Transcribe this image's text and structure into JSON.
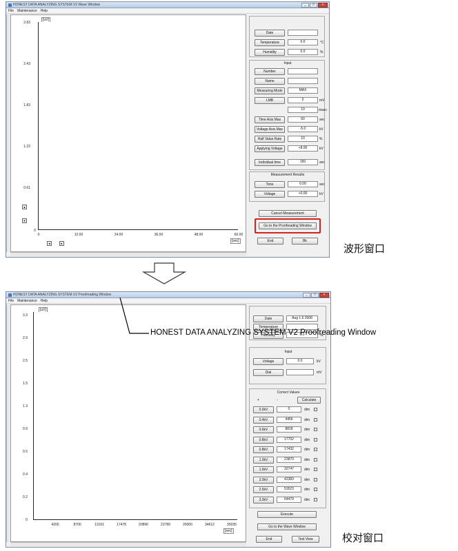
{
  "window1": {
    "title": "HONEST DATA ANALYZING SYSTEM V2 Wave Window",
    "menu": [
      "File",
      "Maintenance",
      "Help"
    ],
    "y_unit": "[uV]",
    "x_unit": "[sec]",
    "y_ticks": [
      "2.83",
      "2.43",
      "1.83",
      "1.22",
      "0.61",
      "0"
    ],
    "x_ticks": [
      "0",
      "12.00",
      "24.00",
      "36.00",
      "48.00",
      "60.00"
    ],
    "side": {
      "date_label": "Date",
      "temperature_label": "Temperature",
      "temperature_value": "0.0",
      "temperature_unit": "°C",
      "humidity_label": "Humidity",
      "humidity_value": "0.0",
      "humidity_unit": "%",
      "input_title": "Input",
      "number_label": "Number",
      "name_label": "Name",
      "method_label": "Measuring Mode",
      "method_value": "MAX",
      "lmb_label": "LMB",
      "lmb_value": "0",
      "lmb_unit": "mV",
      "second_value": "10",
      "second_unit": "msec",
      "time_axis_label": "Time Axis Max",
      "time_axis_value": "60",
      "time_axis_unit": "sec",
      "voltage_axis_label": "Voltage Axis Max",
      "voltage_axis_value": "-5.0",
      "voltage_axis_unit": "kV",
      "half_value_label": "Half Value Rate",
      "half_value_value": "10",
      "half_value_unit": "%",
      "applying_voltage_label": "Applying Voltage",
      "applying_voltage_value": "+8.00",
      "applying_voltage_unit": "kV",
      "individual_label": "Individual time",
      "individual_value": "150",
      "individual_unit": "sec",
      "result_title": "Measurement Results",
      "time_label": "Time",
      "time_value": "0.00",
      "time_unit": "sec",
      "voltage_label": "Voltage",
      "voltage_value": "+0.00",
      "voltage_unit": "kV",
      "cancel_label": "Cancel Measurement",
      "goto_label": "Go to the Proofreading Window",
      "end_label": "End",
      "exit_label": "Bk"
    },
    "caption": "波形窗口"
  },
  "window2": {
    "title": "HONEST DATA ANALYZING SYSTEM V2 Proofreading Window",
    "menu": [
      "File",
      "Maintenance",
      "Help"
    ],
    "y_unit": "[uV]",
    "x_unit": "[sec]",
    "y_ticks": [
      "3.3",
      "2.9",
      "2.5",
      "1.5",
      "1.3",
      "0.9",
      "0.5",
      "0.4",
      "0.2",
      "0"
    ],
    "x_ticks": [
      "4200",
      "8700",
      "13161",
      "17478",
      "20890",
      "22789",
      "26000",
      "34612",
      "35035"
    ],
    "side": {
      "date_label": "Date",
      "date_value": "Aug 1.6 2008",
      "temperature_label": "Temperature",
      "humidity_label": "Humidity",
      "humidity_value": "0.0",
      "humidity_unit": "%",
      "input_title": "Input",
      "voltage_label": "Voltage",
      "voltage_value": "0.0",
      "voltage_unit": "kV",
      "dial_label": "Dial",
      "dial_unit": "mV",
      "correction_title": "Correct Values",
      "radio_a": "+",
      "radio_b": "-",
      "calc_label": "Calculate",
      "rows": [
        {
          "label": "0.0kV",
          "value": "0",
          "unit": "dim"
        },
        {
          "label": "0.4kV",
          "value": "4456",
          "unit": "dim"
        },
        {
          "label": "0.6kV",
          "value": "8818",
          "unit": "dim"
        },
        {
          "label": "0.8kV",
          "value": "17702",
          "unit": "dim"
        },
        {
          "label": "0.8kV",
          "value": "17432",
          "unit": "dim"
        },
        {
          "label": "1.0kV",
          "value": "23870",
          "unit": "dim"
        },
        {
          "label": "1.5kV",
          "value": "32747",
          "unit": "dim"
        },
        {
          "label": "2.0kV",
          "value": "42383",
          "unit": "dim"
        },
        {
          "label": "2.5kV",
          "value": "53523",
          "unit": "dim"
        },
        {
          "label": "3.0kV",
          "value": "64479",
          "unit": "dim"
        }
      ],
      "execute_label": "Execute",
      "goto_label": "Go to the Wave Window",
      "end_label": "End",
      "test_label": "Test View"
    },
    "caption": "校对窗口"
  },
  "callout_text": "HONEST DATA ANALYZING SYSTEM V2 Proofreading Window"
}
